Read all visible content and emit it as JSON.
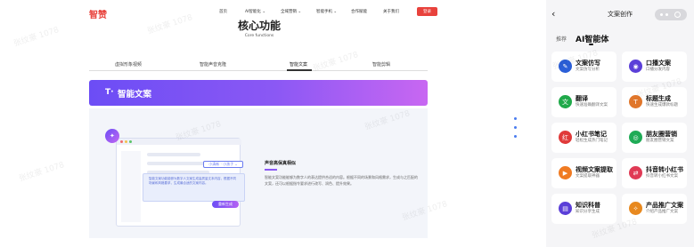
{
  "site": {
    "logo": "智赞",
    "nav": [
      "首页",
      "AI智能化 ⌄",
      "全域营销 ⌄",
      "智能手机 ⌄",
      "合作赋能",
      "关于我们"
    ],
    "login": "登录",
    "title": "核心功能",
    "subtitle": "Core functions",
    "tabs": [
      "虚拟形象视频",
      "智能声音克隆",
      "智能文案",
      "智能剪辑"
    ],
    "active_tab": "智能文案",
    "banner_icon": "T·",
    "banner_title": "智能文案",
    "mock_chip": "小清新 · 小孩子 ⌄",
    "mock_text": "智能文案功能能够为数字人文案生成高质量文本内容，根据不同场景和风格要求，生成最合适的文案内容。",
    "mock_button": "重新生成",
    "feature_title": "声音高保真相似",
    "feature_desc": "智能文案功能能够为数字人的表达提供合适的内容。根据不同的场景和风格需求，生成与之匹配的文案，还可以根据指令要求进行改写、润色、提升效果。",
    "accent": "#e8423c",
    "banner_gradient": [
      "#6c4df5",
      "#c867f2"
    ]
  },
  "app": {
    "title": "文案创作",
    "tab_recommend": "推荐",
    "tab_ai": "AI智能体",
    "cards": [
      {
        "title": "文案仿写",
        "desc": "文案仿写分析",
        "color": "#2b5fd8",
        "icon": "pen-icon"
      },
      {
        "title": "口播文案",
        "desc": "口播分发内容",
        "color": "#5b3fd8",
        "icon": "mic-icon"
      },
      {
        "title": "翻译",
        "desc": "快速准确翻译文案",
        "color": "#20a94a",
        "icon": "translate-icon"
      },
      {
        "title": "标题生成",
        "desc": "快速生成爆款标题",
        "color": "#e0762b",
        "icon": "title-icon"
      },
      {
        "title": "小红书笔记",
        "desc": "轻松生成热门笔记",
        "color": "#e03a3a",
        "icon": "note-icon"
      },
      {
        "title": "朋友圈营销",
        "desc": "朋友圈营销文案",
        "color": "#1fab56",
        "icon": "wechat-icon"
      },
      {
        "title": "视频文案提取",
        "desc": "文案提取神器",
        "color": "#f07b22",
        "icon": "video-icon"
      },
      {
        "title": "抖音转小红书",
        "desc": "抖音转小红书文案",
        "color": "#e03a55",
        "icon": "convert-icon"
      },
      {
        "title": "知识科普",
        "desc": "知识分享生成",
        "color": "#5b3fd8",
        "icon": "book-icon"
      },
      {
        "title": "产品推广文案",
        "desc": "介绍产品推广文案",
        "color": "#e8891f",
        "icon": "megaphone-icon"
      }
    ]
  },
  "watermark": "张纹豪 1078"
}
